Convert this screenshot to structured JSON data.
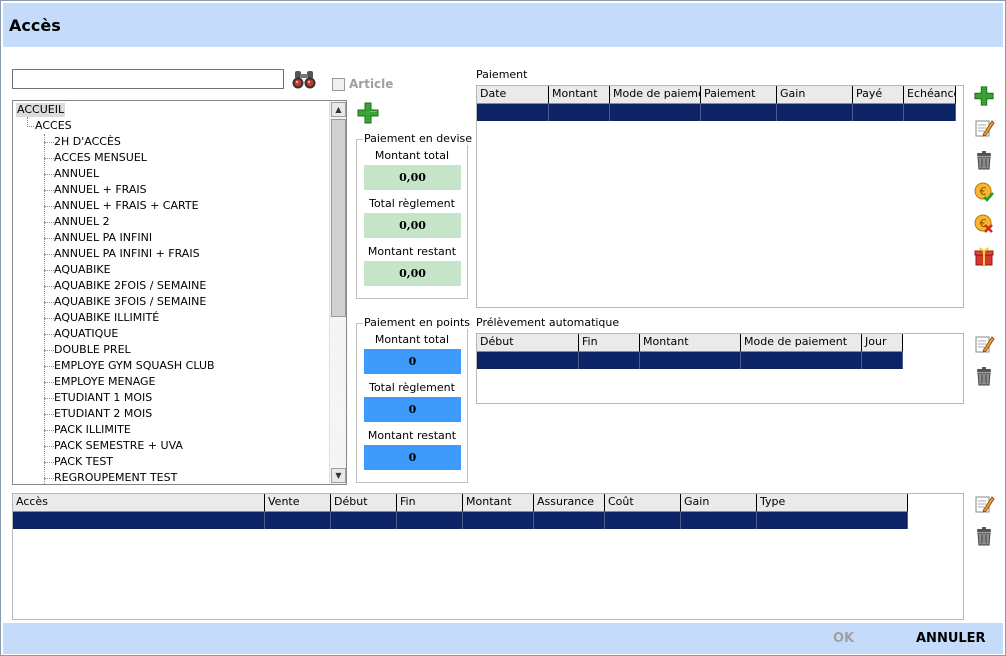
{
  "window": {
    "title": "Accès"
  },
  "search": {
    "value": "",
    "placeholder": ""
  },
  "article": {
    "label": "Article",
    "checked": false
  },
  "tree": {
    "root": "ACCUEIL",
    "group": "ACCES",
    "items": [
      "2H D'ACCÈS",
      "ACCES MENSUEL",
      "ANNUEL",
      "ANNUEL + FRAIS",
      "ANNUEL + FRAIS + CARTE",
      "ANNUEL 2",
      "ANNUEL PA INFINI",
      "ANNUEL PA INFINI + FRAIS",
      "AQUABIKE",
      "AQUABIKE 2FOIS / SEMAINE",
      "AQUABIKE 3FOIS / SEMAINE",
      "AQUABIKE ILLIMITÉ",
      "AQUATIQUE",
      "DOUBLE PREL",
      "EMPLOYE GYM SQUASH CLUB",
      "EMPLOYE MENAGE",
      "ETUDIANT 1 MOIS",
      "ETUDIANT 2 MOIS",
      "PACK ILLIMITE",
      "PACK SEMESTRE + UVA",
      "PACK TEST",
      "REGROUPEMENT TEST"
    ]
  },
  "devise": {
    "title": "Paiement en devise",
    "total_label": "Montant total",
    "total_value": "0,00",
    "reglement_label": "Total règlement",
    "reglement_value": "0,00",
    "restant_label": "Montant restant",
    "restant_value": "0,00"
  },
  "points": {
    "title": "Paiement en points",
    "total_label": "Montant total",
    "total_value": "0",
    "reglement_label": "Total règlement",
    "reglement_value": "0",
    "restant_label": "Montant restant",
    "restant_value": "0"
  },
  "paiement": {
    "label": "Paiement",
    "columns": [
      "Date",
      "Montant",
      "Mode de paiement",
      "Paiement",
      "Gain",
      "Payé",
      "Echéance"
    ]
  },
  "prelevement": {
    "label": "Prélèvement automatique",
    "columns": [
      "Début",
      "Fin",
      "Montant",
      "Mode de paiement",
      "Jour"
    ]
  },
  "acces_table": {
    "columns": [
      "Accès",
      "Vente",
      "Début",
      "Fin",
      "Montant",
      "Assurance",
      "Coût",
      "Gain",
      "Type"
    ]
  },
  "footer": {
    "ok": "OK",
    "cancel": "ANNULER"
  },
  "colors": {
    "title_bar": "#c4dcf9",
    "selected_row": "#0c2465",
    "green_field": "#c5e4c8",
    "blue_field": "#3f9bfb"
  }
}
